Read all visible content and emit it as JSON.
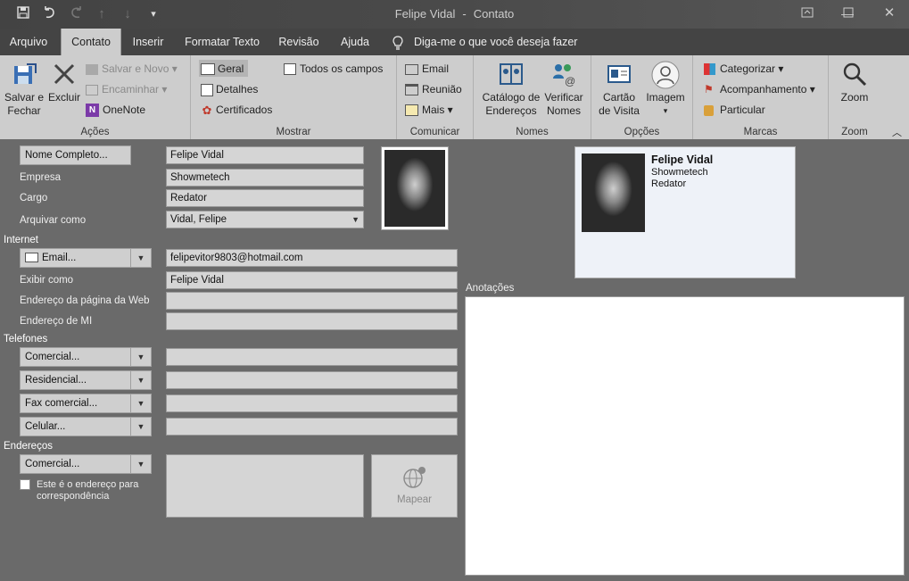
{
  "window": {
    "title": "Felipe Vidal",
    "subtitle": "Contato",
    "separator": "-"
  },
  "tabs": [
    {
      "label": "Arquivo"
    },
    {
      "label": "Contato"
    },
    {
      "label": "Inserir"
    },
    {
      "label": "Formatar Texto"
    },
    {
      "label": "Revisão"
    },
    {
      "label": "Ajuda"
    }
  ],
  "tell_me": "Diga-me o que você deseja fazer",
  "ribbon": {
    "acoes": {
      "label": "Ações",
      "save_close": [
        "Salvar e",
        "Fechar"
      ],
      "delete": "Excluir",
      "save_new": "Salvar e Novo",
      "forward": "Encaminhar",
      "onenote": "OneNote"
    },
    "mostrar": {
      "label": "Mostrar",
      "geral": "Geral",
      "detalhes": "Detalhes",
      "certificados": "Certificados",
      "todos": "Todos os campos"
    },
    "comunicar": {
      "label": "Comunicar",
      "email": "Email",
      "reuniao": "Reunião",
      "mais": "Mais"
    },
    "nomes": {
      "label": "Nomes",
      "catalogo": [
        "Catálogo de",
        "Endereços"
      ],
      "verificar": [
        "Verificar",
        "Nomes"
      ]
    },
    "opcoes": {
      "label": "Opções",
      "cartao": [
        "Cartão",
        "de Visita"
      ],
      "imagem": "Imagem"
    },
    "marcas": {
      "label": "Marcas",
      "categorizar": "Categorizar",
      "acompanhamento": "Acompanhamento",
      "particular": "Particular"
    },
    "zoom": {
      "label": "Zoom",
      "zoom": "Zoom"
    }
  },
  "form": {
    "nome_btn": "Nome Completo...",
    "nome": "Felipe Vidal",
    "empresa_lbl": "Empresa",
    "empresa": "Showmetech",
    "cargo_lbl": "Cargo",
    "cargo": "Redator",
    "arquivar_lbl": "Arquivar como",
    "arquivar": "Vidal, Felipe",
    "internet_sec": "Internet",
    "email_btn": "Email...",
    "email": "felipevitor9803@hotmail.com",
    "exibir_lbl": "Exibir como",
    "exibir": "Felipe Vidal",
    "web_lbl": "Endereço da página da Web",
    "mi_lbl": "Endereço de MI",
    "telefones_sec": "Telefones",
    "phones": [
      {
        "label": "Comercial..."
      },
      {
        "label": "Residencial..."
      },
      {
        "label": "Fax comercial..."
      },
      {
        "label": "Celular..."
      }
    ],
    "enderecos_sec": "Endereços",
    "endereco_btn": "Comercial...",
    "correspondencia": [
      "Este é o endereço para",
      "correspondência"
    ],
    "mapear": "Mapear",
    "anotacoes_lbl": "Anotações"
  },
  "card": {
    "name": "Felipe Vidal",
    "company": "Showmetech",
    "title": "Redator"
  }
}
